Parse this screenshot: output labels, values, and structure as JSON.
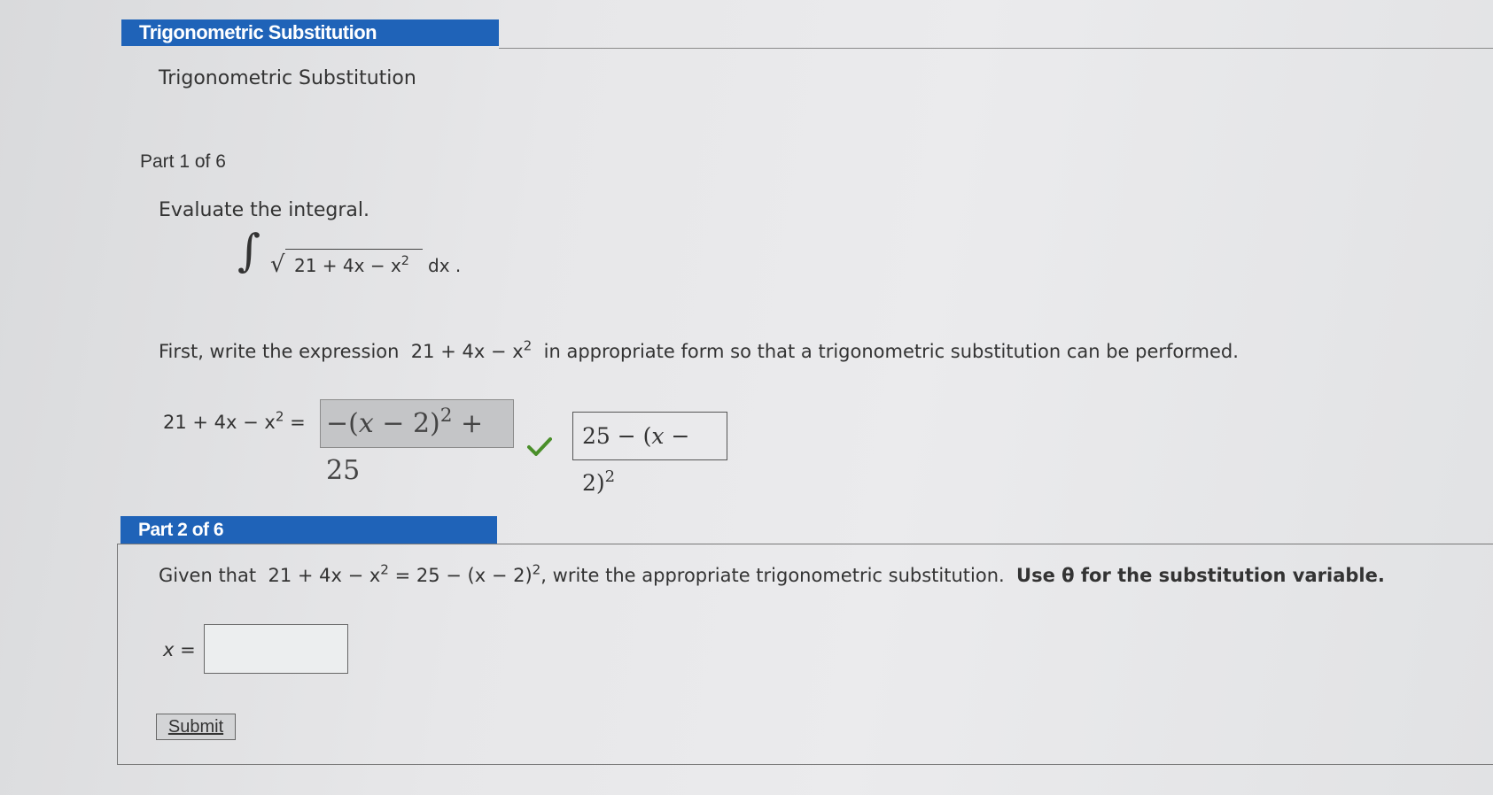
{
  "header": {
    "title": "Trigonometric Substitution"
  },
  "problem": {
    "subtitle": "Trigonometric Substitution"
  },
  "part1": {
    "label": "Part 1 of 6",
    "instruction": "Evaluate the integral.",
    "integral_expr": "21 + 4x − x",
    "integral_exp": "2",
    "integral_tail": "dx .",
    "first_text_before": "First, write the expression",
    "first_expr": "21 + 4x − x",
    "first_exp": "2",
    "first_text_after": "in appropriate form so that a trigonometric substitution can be performed.",
    "lhs": "21 + 4x − x",
    "lhs_exp": "2",
    "lhs_eq": "=",
    "answer_prefix": "−(",
    "answer_var": "x",
    "answer_mid": " − 2)",
    "answer_exp": "2",
    "answer_suffix": " + 25",
    "preview_prefix": "25 − (",
    "preview_var": "x",
    "preview_mid": " − 2)",
    "preview_exp": "2",
    "status_icon": "check-icon",
    "status_color": "#4a8f2a"
  },
  "part2": {
    "label": "Part 2 of 6",
    "given_before": "Given that",
    "given_expr": "21 + 4x − x",
    "given_exp": "2",
    "given_eq": "= 25 − (x − 2)",
    "given_exp2": "2",
    "given_after": ", write the appropriate trigonometric substitution.",
    "bold_instruction": "Use θ for the substitution variable.",
    "x_label": "x =",
    "x_value": "",
    "submit_label": "Submit"
  },
  "colors": {
    "header_blue": "#1f63b8"
  }
}
